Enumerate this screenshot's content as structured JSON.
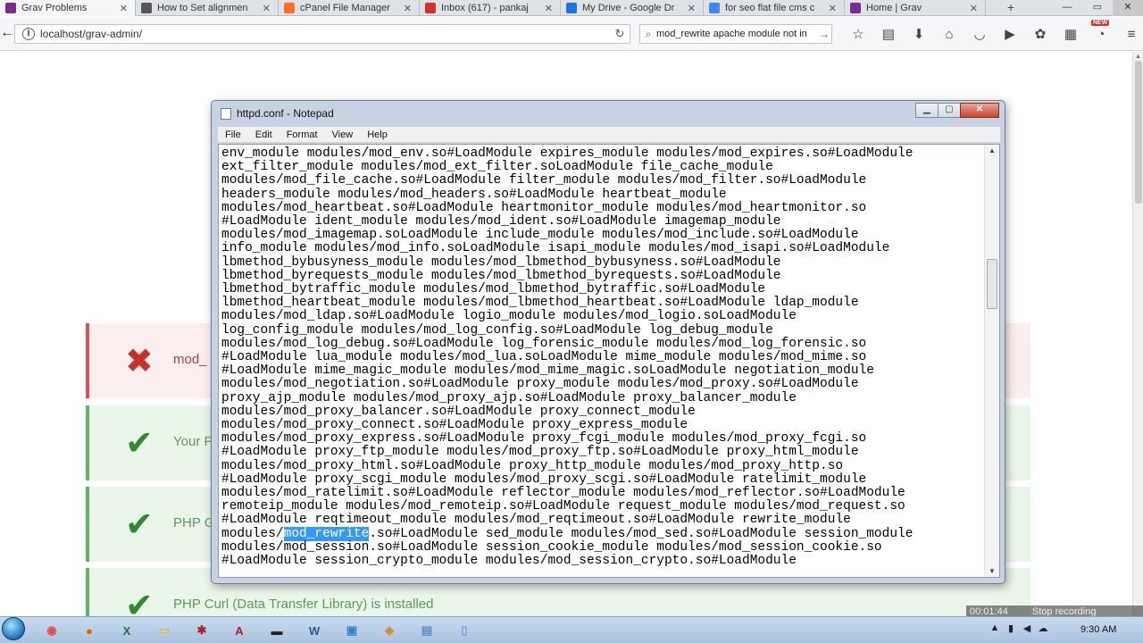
{
  "browser": {
    "tabs": [
      {
        "title": "Grav Problems",
        "favicon_color": "#7b2a8f",
        "active": true
      },
      {
        "title": "How to Set alignmen",
        "favicon_color": "#555555"
      },
      {
        "title": "cPanel File Manager",
        "favicon_color": "#ff6c2c"
      },
      {
        "title": "Inbox (617) - pankaj",
        "favicon_color": "#d93025"
      },
      {
        "title": "My Drive - Google Dr",
        "favicon_color": "#1a73e8"
      },
      {
        "title": "for seo flat file cms c",
        "favicon_color": "#4285f4"
      },
      {
        "title": "Home | Grav",
        "favicon_color": "#7b2a8f"
      }
    ],
    "new_tab": "+",
    "url": "localhost/grav-admin/",
    "search_value": "mod_rewrite apache module not in"
  },
  "page": {
    "rows": [
      {
        "status": "error",
        "text": "mod_"
      },
      {
        "status": "ok",
        "text": "Your P"
      },
      {
        "status": "ok",
        "text": "PHP G"
      },
      {
        "status": "ok",
        "text": "PHP Curl (Data Transfer Library) is installed"
      }
    ]
  },
  "notepad": {
    "title": "httpd.conf - Notepad",
    "menu": [
      "File",
      "Edit",
      "Format",
      "View",
      "Help"
    ],
    "lines": [
      "env_module modules/mod_env.so#LoadModule expires_module modules/mod_expires.so#LoadModule",
      "ext_filter_module modules/mod_ext_filter.soLoadModule file_cache_module",
      "modules/mod_file_cache.so#LoadModule filter_module modules/mod_filter.so#LoadModule",
      "headers_module modules/mod_headers.so#LoadModule heartbeat_module",
      "modules/mod_heartbeat.so#LoadModule heartmonitor_module modules/mod_heartmonitor.so",
      "#LoadModule ident_module modules/mod_ident.so#LoadModule imagemap_module",
      "modules/mod_imagemap.soLoadModule include_module modules/mod_include.so#LoadModule",
      "info_module modules/mod_info.soLoadModule isapi_module modules/mod_isapi.so#LoadModule",
      "lbmethod_bybusyness_module modules/mod_lbmethod_bybusyness.so#LoadModule",
      "lbmethod_byrequests_module modules/mod_lbmethod_byrequests.so#LoadModule",
      "lbmethod_bytraffic_module modules/mod_lbmethod_bytraffic.so#LoadModule",
      "lbmethod_heartbeat_module modules/mod_lbmethod_heartbeat.so#LoadModule ldap_module",
      "modules/mod_ldap.so#LoadModule logio_module modules/mod_logio.soLoadModule",
      "log_config_module modules/mod_log_config.so#LoadModule log_debug_module",
      "modules/mod_log_debug.so#LoadModule log_forensic_module modules/mod_log_forensic.so",
      "#LoadModule lua_module modules/mod_lua.soLoadModule mime_module modules/mod_mime.so",
      "#LoadModule mime_magic_module modules/mod_mime_magic.soLoadModule negotiation_module",
      "modules/mod_negotiation.so#LoadModule proxy_module modules/mod_proxy.so#LoadModule",
      "proxy_ajp_module modules/mod_proxy_ajp.so#LoadModule proxy_balancer_module",
      "modules/mod_proxy_balancer.so#LoadModule proxy_connect_module",
      "modules/mod_proxy_connect.so#LoadModule proxy_express_module",
      "modules/mod_proxy_express.so#LoadModule proxy_fcgi_module modules/mod_proxy_fcgi.so",
      "#LoadModule proxy_ftp_module modules/mod_proxy_ftp.so#LoadModule proxy_html_module",
      "modules/mod_proxy_html.so#LoadModule proxy_http_module modules/mod_proxy_http.so",
      "#LoadModule proxy_scgi_module modules/mod_proxy_scgi.so#LoadModule ratelimit_module",
      "modules/mod_ratelimit.so#LoadModule reflector_module modules/mod_reflector.so#LoadModule",
      "remoteip_module modules/mod_remoteip.so#LoadModule request_module modules/mod_request.so",
      "#LoadModule reqtimeout_module modules/mod_reqtimeout.so#LoadModule rewrite_module",
      "modules/mod_rewrite.so#LoadModule sed_module modules/mod_sed.so#LoadModule session_module",
      "modules/mod_session.so#LoadModule session_cookie_module modules/mod_session_cookie.so",
      "#LoadModule session_crypto_module modules/mod_session_crypto.so#LoadModule"
    ],
    "selection": {
      "line": 28,
      "text": "mod_rewrite"
    }
  },
  "taskbar": {
    "apps": [
      {
        "name": "chrome",
        "glyph": "◉",
        "color": "#e8453c"
      },
      {
        "name": "firefox",
        "glyph": "●",
        "color": "#e66000"
      },
      {
        "name": "excel",
        "glyph": "X",
        "color": "#1e7145"
      },
      {
        "name": "explorer",
        "glyph": "▭",
        "color": "#e6b640"
      },
      {
        "name": "app",
        "glyph": "✱",
        "color": "#b02020"
      },
      {
        "name": "pdf",
        "glyph": "A",
        "color": "#c1121f"
      },
      {
        "name": "terminal",
        "glyph": "▬",
        "color": "#222222"
      },
      {
        "name": "word",
        "glyph": "W",
        "color": "#2b579a"
      },
      {
        "name": "remote",
        "glyph": "▣",
        "color": "#3b7ac4"
      },
      {
        "name": "paint",
        "glyph": "◈",
        "color": "#d08a2a"
      },
      {
        "name": "notes",
        "glyph": "▤",
        "color": "#5b8cc7"
      },
      {
        "name": "notepad",
        "glyph": "▯",
        "color": "#6f9fd0"
      }
    ],
    "clock": "9:30 AM",
    "recording": {
      "time": "00:01:44",
      "action": "Stop recording"
    }
  }
}
